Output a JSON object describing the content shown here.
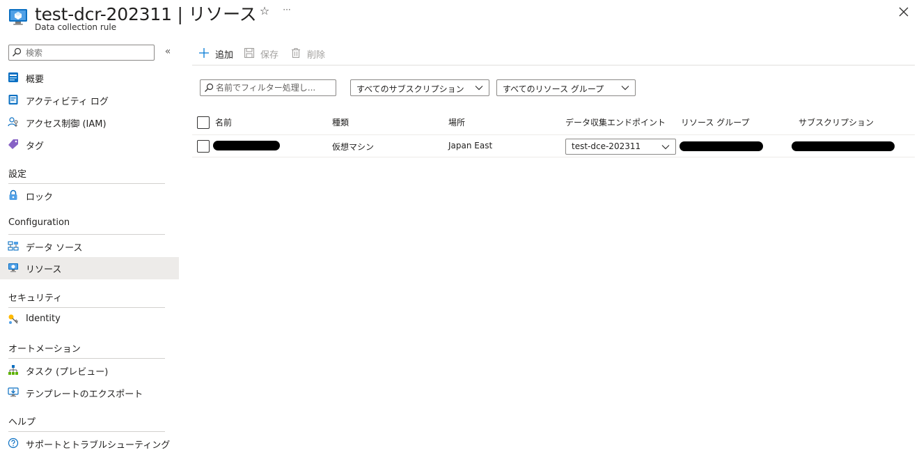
{
  "header": {
    "title": "test-dcr-202311 | リソース",
    "subtitle": "Data collection rule",
    "star_icon": "☆",
    "more_icon": "···"
  },
  "sidebar": {
    "search_placeholder": "検索",
    "collapse_icon": "«",
    "items": [
      {
        "label": "概要",
        "icon": "overview-icon"
      },
      {
        "label": "アクティビティ ログ",
        "icon": "activity-log-icon"
      },
      {
        "label": "アクセス制御 (IAM)",
        "icon": "iam-icon"
      },
      {
        "label": "タグ",
        "icon": "tag-icon"
      }
    ],
    "sections": [
      {
        "heading": "設定",
        "items": [
          {
            "label": "ロック",
            "icon": "lock-icon"
          }
        ]
      },
      {
        "heading": "Configuration",
        "items": [
          {
            "label": "データ ソース",
            "icon": "data-source-icon"
          },
          {
            "label": "リソース",
            "icon": "resource-icon",
            "selected": true
          }
        ]
      },
      {
        "heading": "セキュリティ",
        "items": [
          {
            "label": "Identity",
            "icon": "identity-icon"
          }
        ]
      },
      {
        "heading": "オートメーション",
        "items": [
          {
            "label": "タスク (プレビュー)",
            "icon": "tasks-icon"
          },
          {
            "label": "テンプレートのエクスポート",
            "icon": "export-template-icon"
          }
        ]
      },
      {
        "heading": "ヘルプ",
        "items": [
          {
            "label": "サポートとトラブルシューティング",
            "icon": "help-icon"
          }
        ]
      }
    ]
  },
  "toolbar": {
    "add_label": "追加",
    "save_label": "保存",
    "delete_label": "削除"
  },
  "filters": {
    "name_placeholder": "名前でフィルター処理し...",
    "subscription": "すべてのサブスクリプション",
    "resource_group": "すべてのリソース グループ"
  },
  "table": {
    "columns": [
      "名前",
      "種類",
      "場所",
      "データ収集エンドポイント",
      "リソース グループ",
      "サブスクリプション"
    ],
    "rows": [
      {
        "name": "",
        "type": "仮想マシン",
        "location": "Japan East",
        "endpoint": "test-dce-202311",
        "resource_group": "",
        "subscription": ""
      }
    ]
  },
  "colors": {
    "accent": "#0078d4",
    "selected_bg": "#edebe9",
    "disabled_text": "#a19f9d"
  }
}
